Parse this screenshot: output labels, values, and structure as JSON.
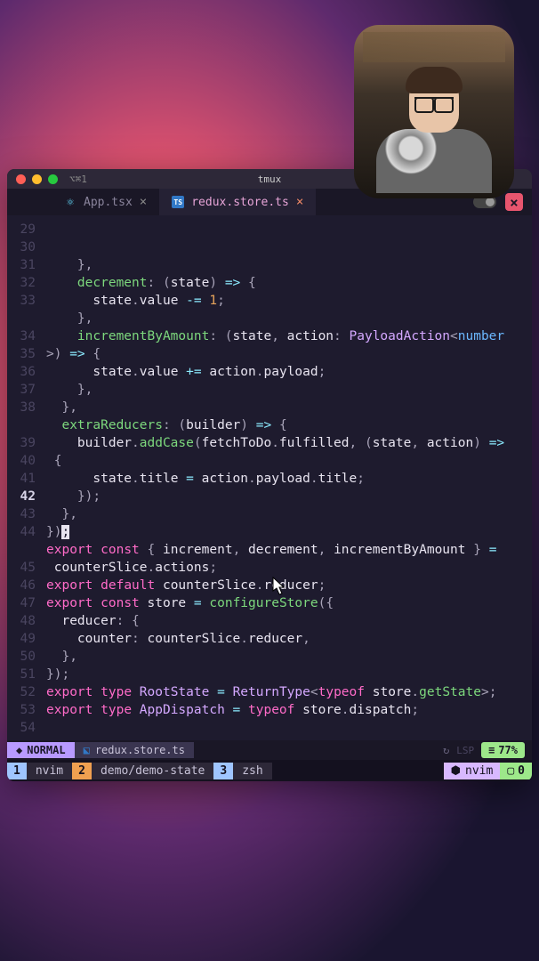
{
  "titlebar": {
    "leftInfo": "⌥⌘1",
    "title": "tmux"
  },
  "tabs": {
    "inactive": {
      "icon": "⚛",
      "label": "App.tsx"
    },
    "active": {
      "icon": "TS",
      "label": "redux.store.ts"
    }
  },
  "gutter_start": 29,
  "current_line": 42,
  "code": [
    [
      [
        "p",
        "    },"
      ]
    ],
    [
      [
        "p",
        "    "
      ],
      [
        "fn",
        "decrement"
      ],
      [
        "p",
        ": ("
      ],
      [
        "id",
        "state"
      ],
      [
        "p",
        ") "
      ],
      [
        "op",
        "=>"
      ],
      [
        "p",
        " {"
      ]
    ],
    [
      [
        "p",
        "      "
      ],
      [
        "id",
        "state"
      ],
      [
        "p",
        "."
      ],
      [
        "pr",
        "value"
      ],
      [
        "p",
        " "
      ],
      [
        "op",
        "-="
      ],
      [
        "p",
        " "
      ],
      [
        "num",
        "1"
      ],
      [
        "p",
        ";"
      ]
    ],
    [
      [
        "p",
        "    },"
      ]
    ],
    [
      [
        "p",
        "    "
      ],
      [
        "fn",
        "incrementByAmount"
      ],
      [
        "p",
        ": ("
      ],
      [
        "id",
        "state"
      ],
      [
        "p",
        ", "
      ],
      [
        "id",
        "action"
      ],
      [
        "p",
        ": "
      ],
      [
        "ty",
        "PayloadAction"
      ],
      [
        "p",
        "<"
      ],
      [
        "k",
        "number"
      ]
    ],
    [
      [
        "p",
        ">) "
      ],
      [
        "op",
        "=>"
      ],
      [
        "p",
        " {"
      ]
    ],
    [
      [
        "p",
        "      "
      ],
      [
        "id",
        "state"
      ],
      [
        "p",
        "."
      ],
      [
        "pr",
        "value"
      ],
      [
        "p",
        " "
      ],
      [
        "op",
        "+="
      ],
      [
        "p",
        " "
      ],
      [
        "id",
        "action"
      ],
      [
        "p",
        "."
      ],
      [
        "pr",
        "payload"
      ],
      [
        "p",
        ";"
      ]
    ],
    [
      [
        "p",
        "    },"
      ]
    ],
    [
      [
        "p",
        "  },"
      ]
    ],
    [
      [
        "p",
        "  "
      ],
      [
        "fn",
        "extraReducers"
      ],
      [
        "p",
        ": ("
      ],
      [
        "id",
        "builder"
      ],
      [
        "p",
        ") "
      ],
      [
        "op",
        "=>"
      ],
      [
        "p",
        " {"
      ]
    ],
    [
      [
        "p",
        "    "
      ],
      [
        "id",
        "builder"
      ],
      [
        "p",
        "."
      ],
      [
        "fn",
        "addCase"
      ],
      [
        "p",
        "("
      ],
      [
        "id",
        "fetchToDo"
      ],
      [
        "p",
        "."
      ],
      [
        "pr",
        "fulfilled"
      ],
      [
        "p",
        ", ("
      ],
      [
        "id",
        "state"
      ],
      [
        "p",
        ", "
      ],
      [
        "id",
        "action"
      ],
      [
        "p",
        ") "
      ],
      [
        "op",
        "=>"
      ]
    ],
    [
      [
        "p",
        " {"
      ]
    ],
    [
      [
        "p",
        "      "
      ],
      [
        "id",
        "state"
      ],
      [
        "p",
        "."
      ],
      [
        "pr",
        "title"
      ],
      [
        "p",
        " "
      ],
      [
        "op",
        "="
      ],
      [
        "p",
        " "
      ],
      [
        "id",
        "action"
      ],
      [
        "p",
        "."
      ],
      [
        "pr",
        "payload"
      ],
      [
        "p",
        "."
      ],
      [
        "pr",
        "title"
      ],
      [
        "p",
        ";"
      ]
    ],
    [
      [
        "p",
        "    });"
      ]
    ],
    [
      [
        "p",
        "  },"
      ]
    ],
    [
      [
        "p",
        "})"
      ],
      [
        "cursor-block",
        ";"
      ]
    ],
    [
      [
        "p",
        ""
      ]
    ],
    [
      [
        "kw",
        "export"
      ],
      [
        "p",
        " "
      ],
      [
        "kw",
        "const"
      ],
      [
        "p",
        " { "
      ],
      [
        "id",
        "increment"
      ],
      [
        "p",
        ", "
      ],
      [
        "id",
        "decrement"
      ],
      [
        "p",
        ", "
      ],
      [
        "id",
        "incrementByAmount"
      ],
      [
        "p",
        " } "
      ],
      [
        "op",
        "="
      ]
    ],
    [
      [
        "p",
        " "
      ],
      [
        "id",
        "counterSlice"
      ],
      [
        "p",
        "."
      ],
      [
        "pr",
        "actions"
      ],
      [
        "p",
        ";"
      ]
    ],
    [
      [
        "kw",
        "export"
      ],
      [
        "p",
        " "
      ],
      [
        "kw",
        "default"
      ],
      [
        "p",
        " "
      ],
      [
        "id",
        "counterSlice"
      ],
      [
        "p",
        "."
      ],
      [
        "pr",
        "reducer"
      ],
      [
        "p",
        ";"
      ]
    ],
    [
      [
        "p",
        ""
      ]
    ],
    [
      [
        "kw",
        "export"
      ],
      [
        "p",
        " "
      ],
      [
        "kw",
        "const"
      ],
      [
        "p",
        " "
      ],
      [
        "id",
        "store"
      ],
      [
        "p",
        " "
      ],
      [
        "op",
        "="
      ],
      [
        "p",
        " "
      ],
      [
        "fn",
        "configureStore"
      ],
      [
        "p",
        "({"
      ]
    ],
    [
      [
        "p",
        "  "
      ],
      [
        "pr",
        "reducer"
      ],
      [
        "p",
        ": {"
      ]
    ],
    [
      [
        "p",
        "    "
      ],
      [
        "pr",
        "counter"
      ],
      [
        "p",
        ": "
      ],
      [
        "id",
        "counterSlice"
      ],
      [
        "p",
        "."
      ],
      [
        "pr",
        "reducer"
      ],
      [
        "p",
        ","
      ]
    ],
    [
      [
        "p",
        "  },"
      ]
    ],
    [
      [
        "p",
        "});"
      ]
    ],
    [
      [
        "p",
        ""
      ]
    ],
    [
      [
        "kw",
        "export"
      ],
      [
        "p",
        " "
      ],
      [
        "kw",
        "type"
      ],
      [
        "p",
        " "
      ],
      [
        "ty",
        "RootState"
      ],
      [
        "p",
        " "
      ],
      [
        "op",
        "="
      ],
      [
        "p",
        " "
      ],
      [
        "ty",
        "ReturnType"
      ],
      [
        "p",
        "<"
      ],
      [
        "kw",
        "typeof"
      ],
      [
        "p",
        " "
      ],
      [
        "id",
        "store"
      ],
      [
        "p",
        "."
      ],
      [
        "fn",
        "getState"
      ],
      [
        "p",
        ">;"
      ]
    ],
    [
      [
        "kw",
        "export"
      ],
      [
        "p",
        " "
      ],
      [
        "kw",
        "type"
      ],
      [
        "p",
        " "
      ],
      [
        "ty",
        "AppDispatch"
      ],
      [
        "p",
        " "
      ],
      [
        "op",
        "="
      ],
      [
        "p",
        " "
      ],
      [
        "kw",
        "typeof"
      ],
      [
        "p",
        " "
      ],
      [
        "id",
        "store"
      ],
      [
        "p",
        "."
      ],
      [
        "pr",
        "dispatch"
      ],
      [
        "p",
        ";"
      ]
    ]
  ],
  "wrapped_lines": [
    5,
    11,
    18
  ],
  "statusline": {
    "mode": "NORMAL",
    "file": "redux.store.ts",
    "lsp": "LSP",
    "percent": "77%"
  },
  "tmux": {
    "win1": {
      "num": "1",
      "label": "nvim"
    },
    "win2": {
      "num": "2",
      "label": "demo/demo-state"
    },
    "win3": {
      "num": "3",
      "label": "zsh"
    },
    "right": {
      "label": "nvim",
      "zero": "0"
    }
  }
}
